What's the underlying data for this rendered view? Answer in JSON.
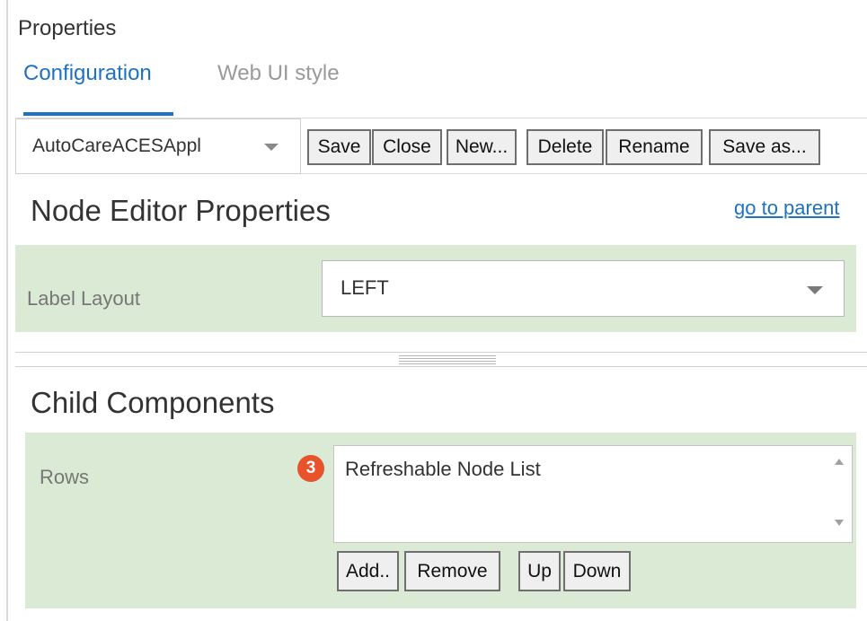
{
  "panel": {
    "title": "Properties"
  },
  "tabs": [
    {
      "label": "Configuration",
      "active": true
    },
    {
      "label": "Web UI style",
      "active": false
    }
  ],
  "toolbar": {
    "config_select": {
      "value": "AutoCareACESAppl"
    },
    "buttons": {
      "save": "Save",
      "close": "Close",
      "new": "New...",
      "delete": "Delete",
      "rename": "Rename",
      "save_as": "Save as..."
    }
  },
  "node_editor": {
    "title": "Node Editor Properties",
    "go_to_parent": "go to parent",
    "label_layout": {
      "label": "Label Layout",
      "value": "LEFT"
    }
  },
  "child_components": {
    "title": "Child Components",
    "rows": {
      "label": "Rows",
      "badge": "3",
      "items": [
        "Refreshable Node List"
      ]
    },
    "buttons": {
      "add": "Add..",
      "remove": "Remove",
      "up": "Up",
      "down": "Down"
    }
  },
  "colors": {
    "accent": "#1e72c2",
    "section_background": "#dbead4",
    "badge": "#e8532c"
  }
}
